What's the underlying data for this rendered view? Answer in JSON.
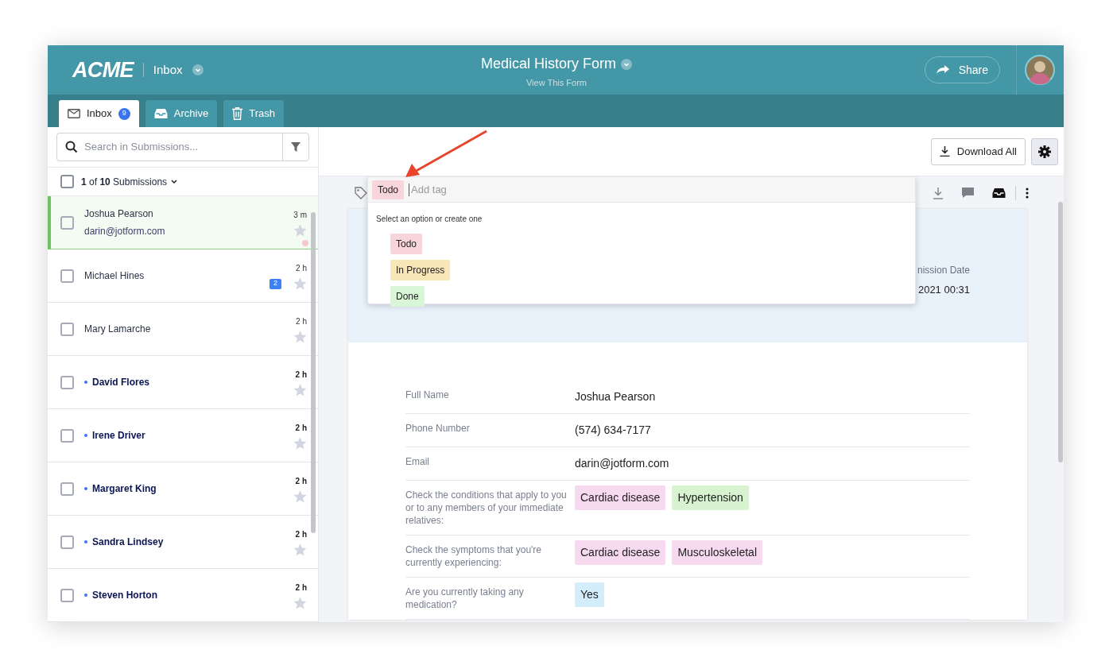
{
  "header": {
    "logo": "ACME",
    "section": "Inbox",
    "form_title": "Medical History Form",
    "form_link": "View This Form",
    "share": "Share"
  },
  "tabs": [
    {
      "label": "Inbox",
      "badge": "9",
      "kind": "envelope",
      "selected": true
    },
    {
      "label": "Archive",
      "kind": "tray",
      "selected": false
    },
    {
      "label": "Trash",
      "kind": "trash",
      "selected": false
    }
  ],
  "search": {
    "placeholder": "Search in Submissions..."
  },
  "list_header": {
    "count": "**1** of **10** Submissions",
    "checked": false
  },
  "submissions": [
    {
      "name": "Joshua Pearson",
      "email": "darin@jotform.com",
      "time": "3 m",
      "checked": false,
      "unread": false,
      "selected": true,
      "color": "#f7c9cf"
    },
    {
      "name": "Michael Hines",
      "time": "2 h",
      "checked": false,
      "unread": false,
      "selected": false,
      "comments": "2"
    },
    {
      "name": "Mary Lamarche",
      "time": "2 h",
      "checked": false,
      "unread": false,
      "selected": false
    },
    {
      "name": "David Flores",
      "time": "2 h",
      "checked": false,
      "unread": true,
      "selected": false
    },
    {
      "name": "Irene Driver",
      "time": "2 h",
      "checked": false,
      "unread": true,
      "selected": false
    },
    {
      "name": "Margaret King",
      "time": "2 h",
      "checked": false,
      "unread": true,
      "selected": false
    },
    {
      "name": "Sandra Lindsey",
      "time": "2 h",
      "checked": false,
      "unread": true,
      "selected": false
    },
    {
      "name": "Steven Horton",
      "time": "2 h",
      "checked": false,
      "unread": true,
      "selected": false
    }
  ],
  "toolbar": {
    "download_all": "Download All"
  },
  "tag_editor": {
    "tags": [
      {
        "label": "Todo",
        "color": "#f8d5da"
      }
    ],
    "placeholder": "Add tag",
    "hint": "Select an option or create one",
    "options": [
      {
        "label": "Todo",
        "color": "#f8d5da"
      },
      {
        "label": "In Progress",
        "color": "#f8e6b6"
      },
      {
        "label": "Done",
        "color": "#d9f7d6"
      }
    ]
  },
  "card_header": {
    "date_label": "nission Date",
    "date_value": "2021 00:31"
  },
  "fields": [
    {
      "label": "Full Name",
      "kind": "text",
      "value": "Joshua Pearson"
    },
    {
      "label": "Phone Number",
      "kind": "text",
      "value": "(574) 634-7177"
    },
    {
      "label": "Email",
      "kind": "text",
      "value": "darin@jotform.com"
    },
    {
      "label": "Check the conditions that apply to you or to any members of your immediate relatives:",
      "kind": "chips",
      "values": [
        {
          "label": "Cardiac disease",
          "color": "#f8daf0"
        },
        {
          "label": "Hypertension",
          "color": "#d7f3cf"
        }
      ]
    },
    {
      "label": "Check the symptoms that you're currently experiencing:",
      "kind": "chips",
      "values": [
        {
          "label": "Cardiac disease",
          "color": "#f8daf0"
        },
        {
          "label": "Musculoskeletal",
          "color": "#f8daf0"
        }
      ]
    },
    {
      "label": "Are you currently taking any medication?",
      "kind": "chips",
      "values": [
        {
          "label": "Yes",
          "color": "#d4edfb"
        }
      ]
    }
  ]
}
